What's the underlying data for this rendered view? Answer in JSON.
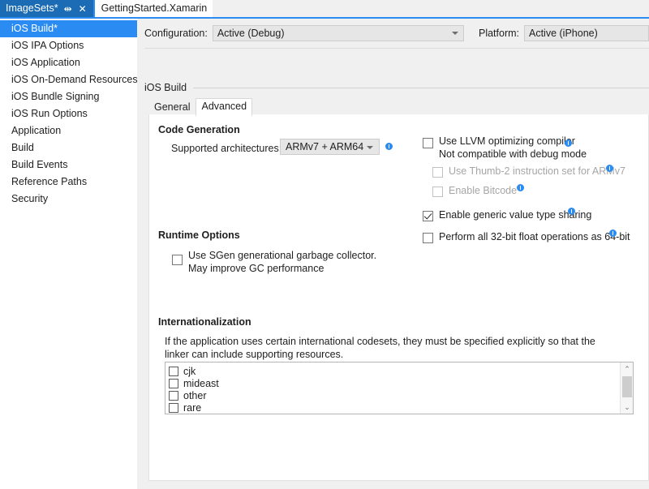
{
  "tabstrip": {
    "tabs": [
      {
        "label": "ImageSets*",
        "active": true,
        "pin_icon": "pin-icon",
        "close_icon": "close-icon"
      },
      {
        "label": "GettingStarted.Xamarin",
        "active": false
      }
    ],
    "pin_glyph": "⇹",
    "close_glyph": "✕"
  },
  "sidebar": {
    "items": [
      {
        "label": "iOS Build*",
        "selected": true
      },
      {
        "label": "iOS IPA Options",
        "selected": false
      },
      {
        "label": "iOS Application",
        "selected": false
      },
      {
        "label": "iOS On-Demand Resources",
        "selected": false
      },
      {
        "label": "iOS Bundle Signing",
        "selected": false
      },
      {
        "label": "iOS Run Options",
        "selected": false
      },
      {
        "label": "Application",
        "selected": false
      },
      {
        "label": "Build",
        "selected": false
      },
      {
        "label": "Build Events",
        "selected": false
      },
      {
        "label": "Reference Paths",
        "selected": false
      },
      {
        "label": "Security",
        "selected": false
      }
    ]
  },
  "configbar": {
    "configuration_label": "Configuration:",
    "configuration_value": "Active (Debug)",
    "platform_label": "Platform:",
    "platform_value": "Active (iPhone)"
  },
  "group": {
    "title": "iOS Build"
  },
  "subtabs": [
    {
      "label": "General",
      "active": false
    },
    {
      "label": "Advanced",
      "active": true
    }
  ],
  "code_generation": {
    "title": "Code Generation",
    "arch_label": "Supported architectures:",
    "arch_value": "ARMv7 + ARM64",
    "llvm": {
      "label": "Use LLVM optimizing compiler",
      "sublabel": "Not compatible with debug mode",
      "checked": false
    },
    "thumb2": {
      "label": "Use Thumb-2 instruction set for ARMv7",
      "checked": false,
      "disabled": true
    },
    "bitcode": {
      "label": "Enable Bitcode",
      "checked": false,
      "disabled": true
    },
    "generic_value_sharing": {
      "label": "Enable generic value type sharing",
      "checked": true
    },
    "float_32_to_64": {
      "label": "Perform all 32-bit float operations as 64-bit",
      "checked": false
    }
  },
  "runtime_options": {
    "title": "Runtime Options",
    "sgen": {
      "label": "Use SGen generational garbage collector.",
      "sublabel": "May improve GC performance",
      "checked": false
    }
  },
  "internationalization": {
    "title": "Internationalization",
    "description": "If the application uses certain international codesets, they must be specified explicitly so that the linker can include supporting resources.",
    "codesets": [
      {
        "label": "cjk",
        "checked": false
      },
      {
        "label": "mideast",
        "checked": false
      },
      {
        "label": "other",
        "checked": false
      },
      {
        "label": "rare",
        "checked": false
      }
    ],
    "scroll_up_glyph": "⌃",
    "scroll_down_glyph": "⌄"
  },
  "colors": {
    "accent_blue": "#2a8bf2",
    "tab_active_blue": "#1c6cb5",
    "panel_bg": "#ffffff",
    "chrome_bg": "#f0f0f0"
  }
}
